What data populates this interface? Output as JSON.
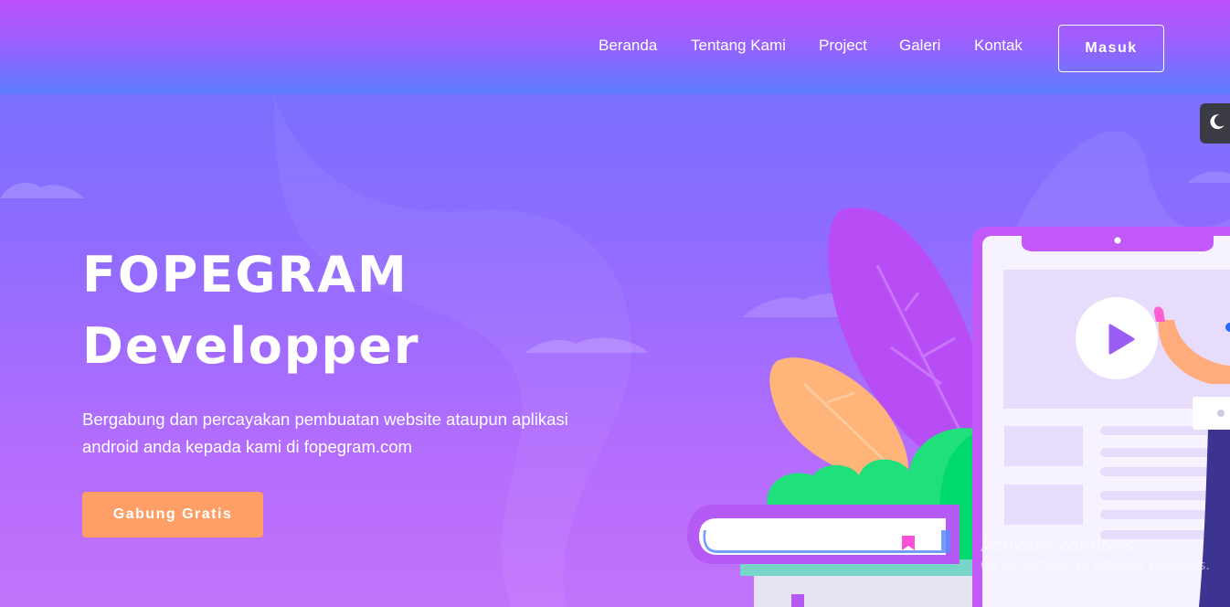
{
  "nav": {
    "items": [
      {
        "label": "Beranda"
      },
      {
        "label": "Tentang Kami"
      },
      {
        "label": "Project"
      },
      {
        "label": "Galeri"
      },
      {
        "label": "Kontak"
      }
    ],
    "login_label": "Masuk"
  },
  "theme_toggle": {
    "icon": "moon-icon"
  },
  "hero": {
    "title_line1": "FOPEGRAM",
    "title_line2": "Developper",
    "description": "Bergabung dan percayakan pembuatan website ataupun aplikasi android anda kepada kami di fopegram.com",
    "cta_label": "Gabung Gratis"
  },
  "watermark": {
    "title": "Activate Windows",
    "subtitle": "Go to Settings to activate Windows."
  },
  "colors": {
    "accent": "#ff9f67",
    "header_top": "#bd51fd",
    "header_bottom": "#5b7dfd",
    "hero_top": "#6f72ff",
    "hero_bottom": "#c273fb"
  }
}
